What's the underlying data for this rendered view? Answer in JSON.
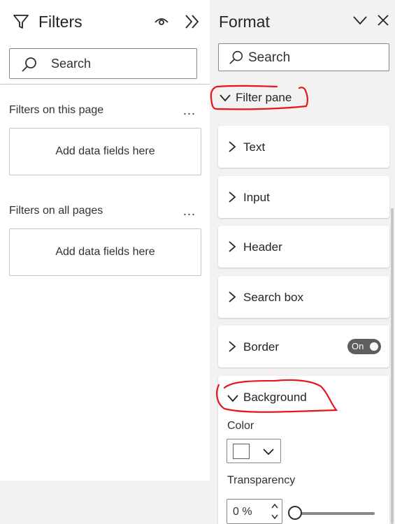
{
  "filters_pane": {
    "title": "Filters",
    "search_placeholder": "Search",
    "sections": [
      {
        "label": "Filters on this page",
        "dropzone": "Add data fields here"
      },
      {
        "label": "Filters on all pages",
        "dropzone": "Add data fields here"
      }
    ],
    "more": "..."
  },
  "format_pane": {
    "title": "Format",
    "search_placeholder": "Search",
    "group": {
      "label": "Filter pane",
      "expanded": true
    },
    "cards": [
      {
        "label": "Text"
      },
      {
        "label": "Input"
      },
      {
        "label": "Header"
      },
      {
        "label": "Search box"
      },
      {
        "label": "Border",
        "toggle": "On"
      }
    ],
    "background": {
      "label": "Background",
      "color_label": "Color",
      "color_value": "#ffffff",
      "transparency_label": "Transparency",
      "transparency_value": "0 %",
      "transparency_level": 0
    }
  },
  "annotation_color": "#e8151b"
}
